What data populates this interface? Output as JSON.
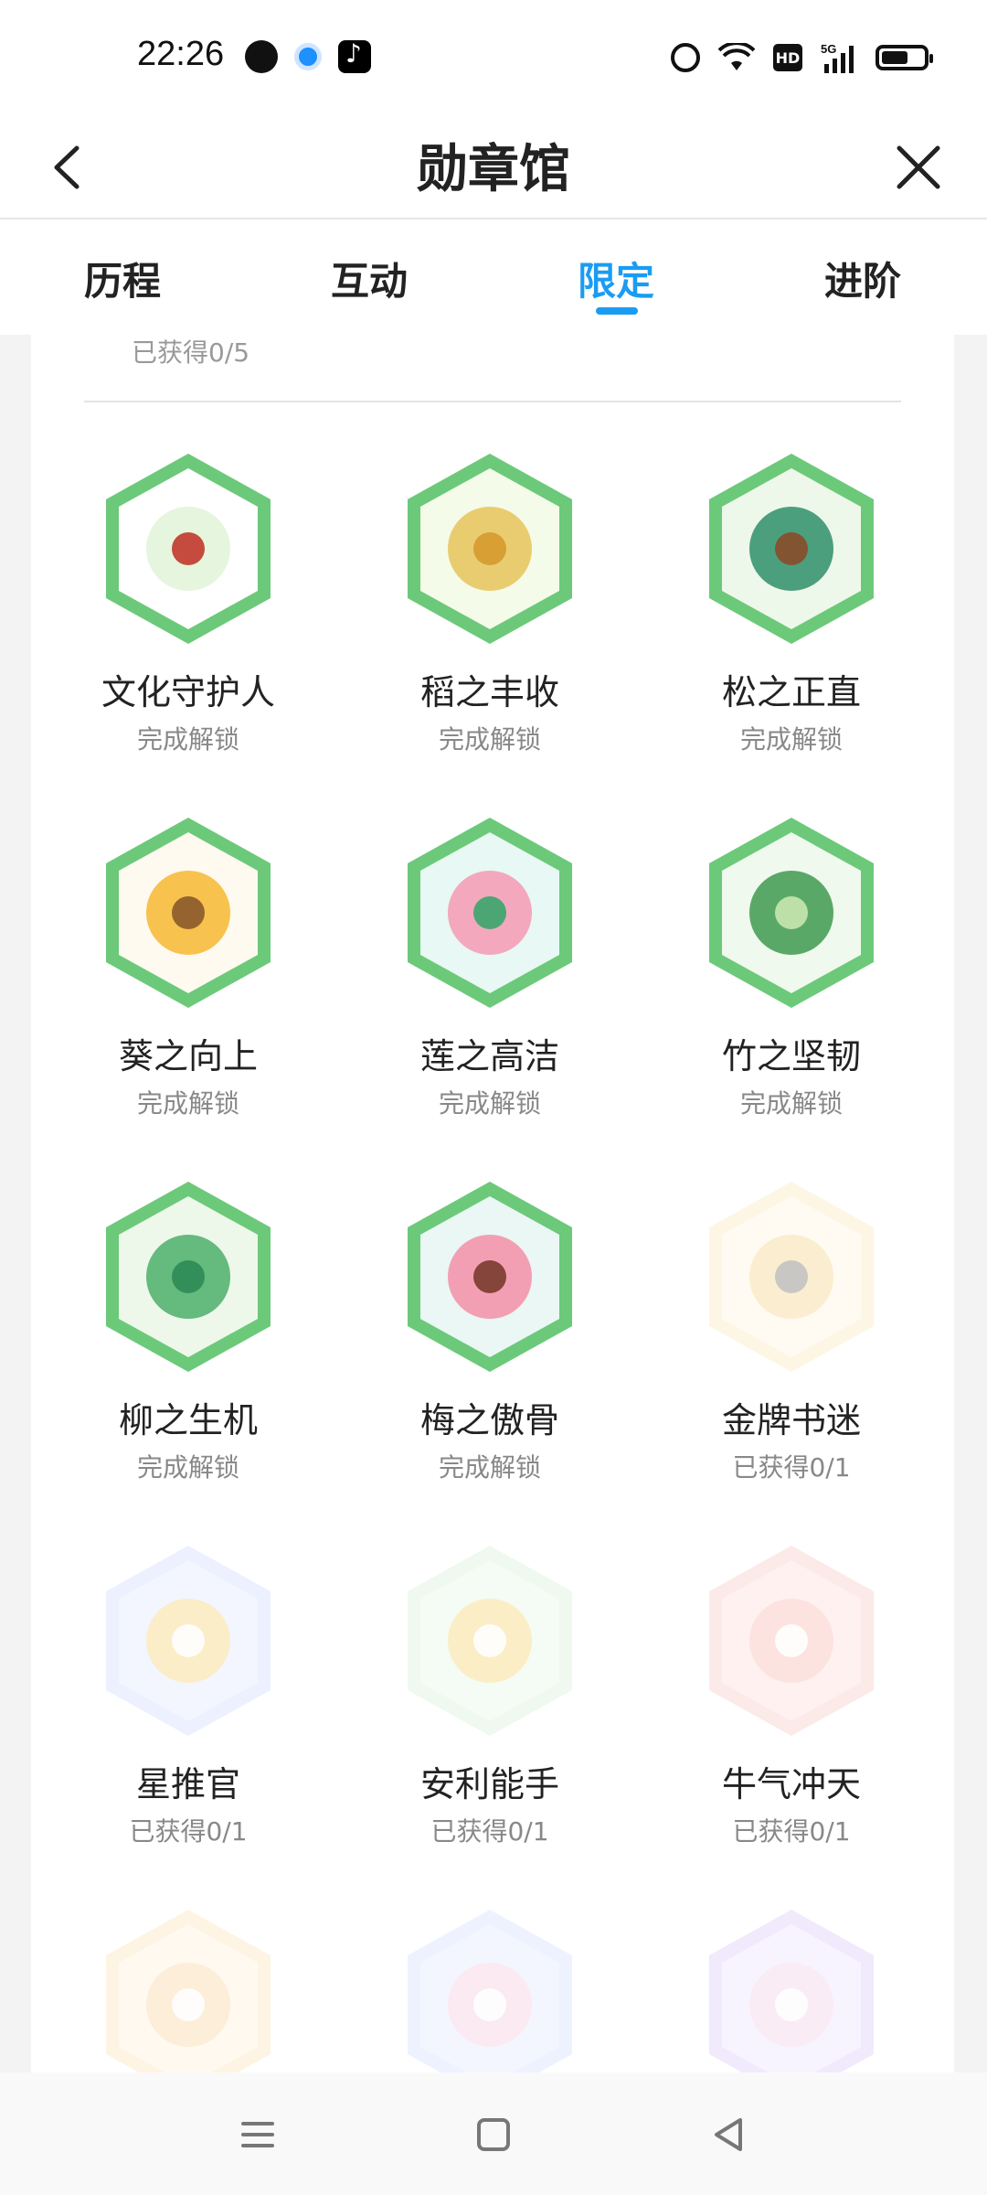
{
  "status_bar": {
    "time": "22:26",
    "hd": "HD",
    "network": "5G"
  },
  "header": {
    "title": "勋章馆"
  },
  "tabs": [
    {
      "label": "历程"
    },
    {
      "label": "互动"
    },
    {
      "label": "限定",
      "active": true
    },
    {
      "label": "进阶"
    }
  ],
  "section": {
    "partial_count": "已获得0/5"
  },
  "badges": [
    {
      "name": "文化守护人",
      "status": "完成解锁",
      "icon": "village-house-icon",
      "locked": false
    },
    {
      "name": "稻之丰收",
      "status": "完成解锁",
      "icon": "rice-harvest-icon",
      "locked": false
    },
    {
      "name": "松之正直",
      "status": "完成解锁",
      "icon": "pine-tree-icon",
      "locked": false
    },
    {
      "name": "葵之向上",
      "status": "完成解锁",
      "icon": "sunflower-icon",
      "locked": false
    },
    {
      "name": "莲之高洁",
      "status": "完成解锁",
      "icon": "lotus-icon",
      "locked": false
    },
    {
      "name": "竹之坚韧",
      "status": "完成解锁",
      "icon": "bamboo-icon",
      "locked": false
    },
    {
      "name": "柳之生机",
      "status": "完成解锁",
      "icon": "willow-icon",
      "locked": false
    },
    {
      "name": "梅之傲骨",
      "status": "完成解锁",
      "icon": "plum-blossom-icon",
      "locked": false
    },
    {
      "name": "金牌书迷",
      "status": "已获得0/1",
      "icon": "book-reader-icon",
      "locked": true
    },
    {
      "name": "星推官",
      "status": "已获得0/1",
      "icon": "star-icon",
      "locked": true
    },
    {
      "name": "安利能手",
      "status": "已获得0/1",
      "icon": "hashtag-icon",
      "locked": true
    },
    {
      "name": "牛气冲天",
      "status": "已获得0/1",
      "icon": "ox-icon",
      "locked": true
    },
    {
      "name": "",
      "status": "",
      "icon": "leaf-icon",
      "locked": true
    },
    {
      "name": "",
      "status": "",
      "icon": "cloud-icon",
      "locked": true
    },
    {
      "name": "",
      "status": "",
      "icon": "flower-icon",
      "locked": true
    }
  ],
  "colors": {
    "accent": "#1a9cf2",
    "badge_green": "#6cc97a"
  }
}
